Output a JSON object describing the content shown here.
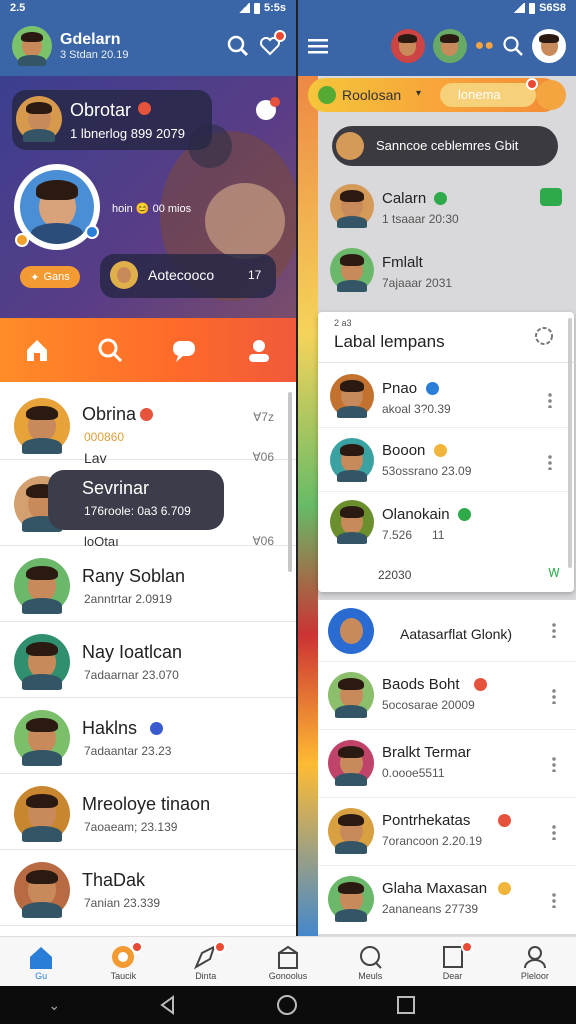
{
  "status_left": {
    "time": "2.5",
    "right": "5:5s"
  },
  "status_right": {
    "time": "",
    "right": "S6S8"
  },
  "left": {
    "header": {
      "title": "Gdelarn",
      "subtitle": "3  Stdan 20.19"
    },
    "hero": {
      "top_card": {
        "name": "Obrotar",
        "sub": "1 lbnerlog 899 2079"
      },
      "mid_text": "hoin 😊 00 mios",
      "pill_label": "Gans",
      "bottom_card": {
        "name": "Aotecooco"
      },
      "bottom_card_extra": "17"
    },
    "tabs": [
      "home",
      "search",
      "chat",
      "profile"
    ],
    "list": [
      {
        "name": "Obrina",
        "sub1": "000860",
        "sub2": "Lav",
        "meta1": "Ɐ7z",
        "meta2": "Ɐ06",
        "color": "#e7a23a"
      },
      {
        "name": "Sevrinar",
        "sub1": "176roole: 0a3 6.709",
        "sub2": "loOtaı",
        "meta1": "",
        "meta2": "Ɐ06",
        "color": "#d4a070"
      },
      {
        "name": "Rany Soblan",
        "sub1": "2anntrtar 2.0919",
        "sub2": "",
        "meta1": "",
        "meta2": "",
        "color": "#6bb86b"
      },
      {
        "name": "Nay Ioatlcan",
        "sub1": "7adaarnar 23.070",
        "sub2": "",
        "meta1": "",
        "meta2": "",
        "color": "#2f8f6f"
      },
      {
        "name": "Haklns",
        "sub1": "7adaantar 23.23",
        "sub2": "",
        "meta1": "",
        "meta2": "",
        "color": "#7cbf6b"
      },
      {
        "name": "Mreoloye tinaon",
        "sub1": "7aoaeam; 23.139",
        "sub2": "",
        "meta1": "",
        "meta2": "",
        "color": "#c8862e"
      },
      {
        "name": "ThaDak",
        "sub1": "7anian 23.339",
        "sub2": "",
        "meta1": "",
        "meta2": "",
        "color": "#b86b43"
      }
    ]
  },
  "right": {
    "pill": {
      "label": "Roolosan",
      "action": "lonema"
    },
    "banner": "Sanncoe ceblemres Gbit",
    "top_rows": [
      {
        "name": "Calarn",
        "sub": "1 tsaaar 20:30",
        "color": "#d69a58"
      },
      {
        "name": "Fmlalt",
        "sub": "7ajaaar 2031",
        "color": "#6bb86b"
      }
    ],
    "panel": {
      "small": "2 a3",
      "title": "Labal lempans",
      "rows": [
        {
          "name": "Pnao",
          "sub": "akoal 3?0.39",
          "color": "#c3712e"
        },
        {
          "name": "Booon",
          "sub": "53ossrano 23.09",
          "color": "#3aa2a0"
        },
        {
          "name": "Olanokain",
          "sub": "7.526",
          "extra": "11",
          "color": "#6a8f2c"
        }
      ],
      "footer_left": "22030",
      "footer_right": "Ꮃ"
    },
    "lower_rows": [
      {
        "name": "Aatasarflat Glonk)",
        "sub": "",
        "color": "#2a6bd1"
      },
      {
        "name": "Baods Boht",
        "sub": "5ocosarae 20009",
        "color": "#8bbf6b"
      },
      {
        "name": "Bralkt Termar",
        "sub": "0.oooe5511",
        "color": "#c0446a"
      },
      {
        "name": "Pontrhekatas",
        "sub": "7orancoon 2.20.19",
        "color": "#d8a040"
      },
      {
        "name": "Glaha Maxasan",
        "sub": "2ananeans 27739",
        "color": "#6bb86b"
      }
    ]
  },
  "nav": [
    {
      "label": "Gu",
      "icon": "home-icon"
    },
    {
      "label": "Taucik",
      "icon": "target-icon"
    },
    {
      "label": "Dinta",
      "icon": "rocket-icon"
    },
    {
      "label": "Gonoolus",
      "icon": "gift-icon"
    },
    {
      "label": "Meuls",
      "icon": "compass-icon"
    },
    {
      "label": "Dear",
      "icon": "inbox-icon"
    },
    {
      "label": "Pleloor",
      "icon": "person-icon"
    }
  ]
}
